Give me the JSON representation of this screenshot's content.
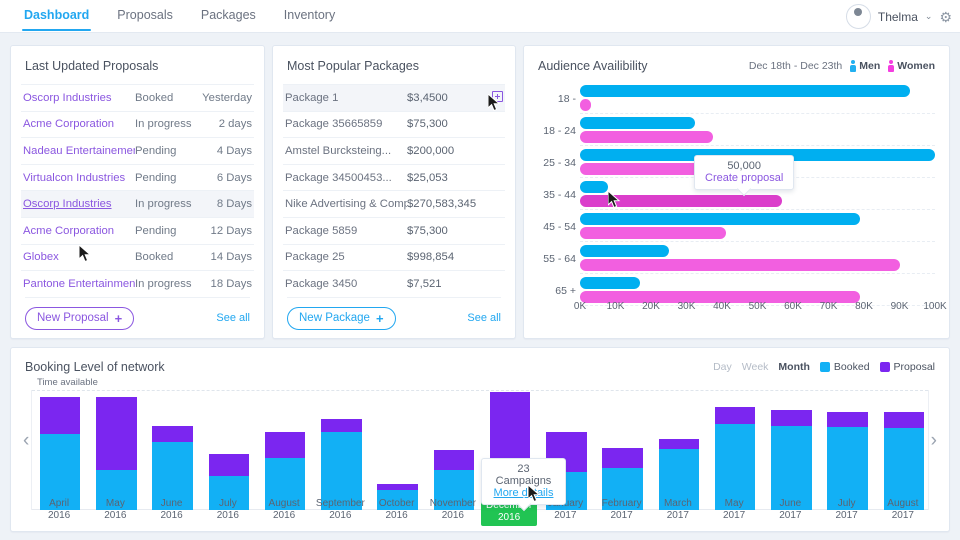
{
  "nav": {
    "tabs": [
      {
        "label": "Dashboard",
        "active": true
      },
      {
        "label": "Proposals",
        "active": false
      },
      {
        "label": "Packages",
        "active": false
      },
      {
        "label": "Inventory",
        "active": false
      }
    ],
    "user_name": "Thelma",
    "caret": "⌄",
    "gear": "⚙"
  },
  "proposals_card": {
    "title": "Last Updated Proposals",
    "rows": [
      {
        "name": "Oscorp Industries",
        "status": "Booked",
        "when": "Yesterday",
        "hover": false
      },
      {
        "name": "Acme Corporation",
        "status": "In progress",
        "when": "2 days",
        "hover": false
      },
      {
        "name": "Nadeau Entertainement",
        "status": "Pending",
        "when": "4 Days",
        "hover": false
      },
      {
        "name": "Virtualcon Industries",
        "status": "Pending",
        "when": "6 Days",
        "hover": false
      },
      {
        "name": "Oscorp Industries",
        "status": "In progress",
        "when": "8 Days",
        "hover": true
      },
      {
        "name": "Acme Corporation",
        "status": "Pending",
        "when": "12 Days",
        "hover": false
      },
      {
        "name": "Globex",
        "status": "Booked",
        "when": "14 Days",
        "hover": false
      },
      {
        "name": "Pantone Entertainment",
        "status": "In progress",
        "when": "18 Days",
        "hover": false
      }
    ],
    "new_button": "New Proposal",
    "plus": "+",
    "see_all": "See all",
    "accent": "#8b57e0"
  },
  "packages_card": {
    "title": "Most Popular Packages",
    "rows": [
      {
        "name": "Package 1",
        "price": "$3,4500",
        "hover": true
      },
      {
        "name": "Package 35665859",
        "price": "$75,300",
        "hover": false
      },
      {
        "name": "Amstel Burcksteing...",
        "price": "$200,000",
        "hover": false
      },
      {
        "name": "Package 34500453...",
        "price": "$25,053",
        "hover": false
      },
      {
        "name": "Nike Advertising & Company",
        "price": "$270,583,345",
        "hover": false
      },
      {
        "name": "Package 5859",
        "price": "$75,300",
        "hover": false
      },
      {
        "name": "Package 25",
        "price": "$998,854",
        "hover": false
      },
      {
        "name": "Package 3450",
        "price": "$7,521",
        "hover": false
      }
    ],
    "new_button": "New Package",
    "plus": "+",
    "see_all": "See all",
    "accent": "#22a7f0"
  },
  "audience_card": {
    "title": "Audience Availibility",
    "date_range": "Dec 18th - Dec 23th",
    "legend": [
      {
        "label": "Men",
        "color": "#22b0f0"
      },
      {
        "label": "Women",
        "color": "#f43ee0"
      }
    ],
    "tooltip": {
      "value": "50,000",
      "action": "Create proposal"
    }
  },
  "booking_card": {
    "title": "Booking Level of network",
    "time_available_label": "Time available",
    "ranges": [
      {
        "label": "Day",
        "active": false
      },
      {
        "label": "Week",
        "active": false
      },
      {
        "label": "Month",
        "active": true
      }
    ],
    "legend": [
      {
        "label": "Booked",
        "color": "#12b0f5"
      },
      {
        "label": "Proposal",
        "color": "#7b26f0"
      }
    ],
    "tooltip": {
      "value": "23 Campaigns",
      "action": "More details"
    },
    "selected_month": "December 2016",
    "prev_arrow": "‹",
    "next_arrow": "›"
  },
  "chart_data": [
    {
      "type": "bar",
      "orientation": "horizontal",
      "title": "Audience Availibility",
      "subtitle": "Dec 18th - Dec 23th",
      "xlabel": "",
      "ylabel": "",
      "categories": [
        "18 -",
        "18 - 24",
        "25 - 34",
        "35 - 44",
        "45 - 54",
        "55 - 64",
        "65 +"
      ],
      "xlim": [
        0,
        100000
      ],
      "xticks": [
        "0K",
        "10K",
        "20K",
        "30K",
        "40K",
        "50K",
        "60K",
        "70K",
        "80K",
        "90K",
        "100K"
      ],
      "xtick_values": [
        0,
        10000,
        20000,
        30000,
        40000,
        50000,
        60000,
        70000,
        80000,
        90000,
        100000
      ],
      "grid": true,
      "legend": [
        "Men",
        "Women"
      ],
      "legend_position": "top-right",
      "series": [
        {
          "name": "Men",
          "color": "#00aff0",
          "values": [
            93000,
            32500,
            100000,
            8000,
            79000,
            25000,
            17000
          ]
        },
        {
          "name": "Women",
          "color": "#f25fe0",
          "values": [
            3000,
            37500,
            50000,
            57000,
            41000,
            90000,
            79000
          ]
        }
      ],
      "annotations": [
        {
          "text": "50,000",
          "action": "Create proposal",
          "category": "25 - 34",
          "series": "Women"
        }
      ]
    },
    {
      "type": "bar",
      "orientation": "vertical",
      "stacked": true,
      "title": "Booking Level of network",
      "xlabel": "",
      "ylabel": "Time available",
      "categories": [
        "April 2016",
        "May 2016",
        "June 2016",
        "July 2016",
        "August 2016",
        "September 2016",
        "October 2016",
        "November 2016",
        "December 2016",
        "January 2017",
        "February 2017",
        "March 2017",
        "May 2017",
        "June 2017",
        "July 2017",
        "August 2017"
      ],
      "ylim": [
        0,
        100
      ],
      "grid": false,
      "legend": [
        "Booked",
        "Proposal"
      ],
      "legend_position": "top-right",
      "series": [
        {
          "name": "Booked",
          "color": "#12b0f5",
          "values": [
            63,
            33,
            57,
            28,
            43,
            65,
            17,
            33,
            4,
            32,
            35,
            51,
            72,
            70,
            69,
            68
          ]
        },
        {
          "name": "Proposal",
          "color": "#7b26f0",
          "values": [
            31,
            61,
            13,
            19,
            22,
            11,
            5,
            17,
            94,
            33,
            17,
            8,
            14,
            13,
            13,
            14
          ]
        }
      ],
      "highlight": {
        "category": "December 2016",
        "color": "#21c453"
      },
      "annotations": [
        {
          "text": "23 Campaigns",
          "action": "More details",
          "category": "December 2016"
        }
      ]
    }
  ]
}
